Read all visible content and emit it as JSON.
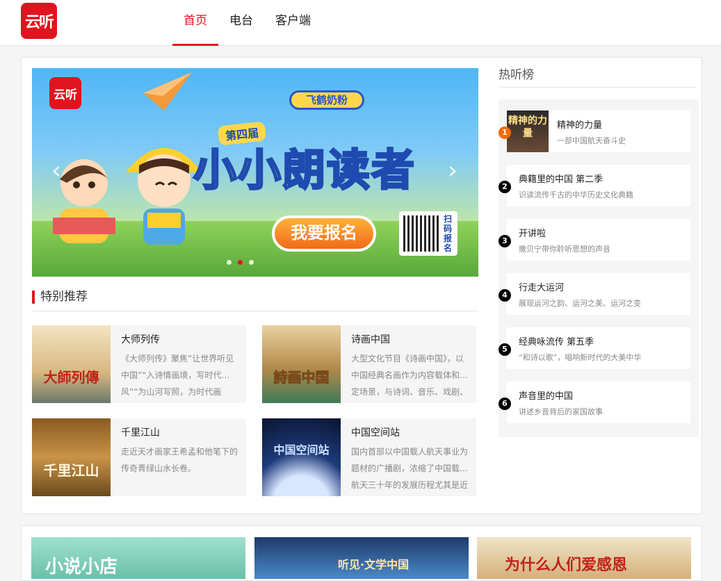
{
  "header": {
    "logo_text": "云听",
    "nav": [
      "首页",
      "电台",
      "客户端"
    ]
  },
  "banner": {
    "logo_text": "云听",
    "brand": "飞鹤奶粉",
    "edition": "第四届",
    "headline": "小小朗读者",
    "cta": "我要报名",
    "qr_label": "扫码报名",
    "prev_icon": "chevron-left-icon",
    "next_icon": "chevron-right-icon"
  },
  "special": {
    "title": "特别推荐",
    "items": [
      {
        "title": "大师列传",
        "cover_text": "大師列傳",
        "desc": "《大师列传》聚焦“让世界听见中国”“入诗情画境，写时代…风”“为山河写照，为时代画"
      },
      {
        "title": "诗画中国",
        "cover_text": "詩画中国",
        "desc": "大型文化节目《诗画中国》，以中国经典名画作为内容载体和…定场景，与诗词、音乐、戏剧、"
      },
      {
        "title": "千里江山",
        "cover_text": "千里江山",
        "desc": "走近天才画家王希孟和他笔下的传奇青绿山水长卷。"
      },
      {
        "title": "中国空间站",
        "cover_text": "中国空间站",
        "desc": "国内首部以中国载人航天事业为题材的广播剧，浓缩了中国载…航天三十年的发展历程尤其是近"
      }
    ]
  },
  "rank": {
    "title": "热听榜",
    "items": [
      {
        "num": "1",
        "name": "精神的力量",
        "sub": "一部中国航天奋斗史",
        "thumb": "精神的力量"
      },
      {
        "num": "2",
        "name": "典籍里的中国  第二季",
        "sub": "识读流传千古的中华历史文化典籍"
      },
      {
        "num": "3",
        "name": "开讲啦",
        "sub": "撒贝宁带你聆听思想的声音"
      },
      {
        "num": "4",
        "name": "行走大运河",
        "sub": "展现运河之韵、运河之美、运河之变"
      },
      {
        "num": "5",
        "name": "经典咏流传  第五季",
        "sub": "“和诗以歌”，唱响新时代的大美中华"
      },
      {
        "num": "6",
        "name": "声音里的中国",
        "sub": "讲述乡音背后的家国故事"
      }
    ]
  },
  "bottom": {
    "tiles": [
      "小说小店",
      "听见·文学中国",
      "为什么人们爱感恩"
    ]
  },
  "colors": {
    "accent": "#e0141e",
    "hot_rank": "#f56a00"
  }
}
